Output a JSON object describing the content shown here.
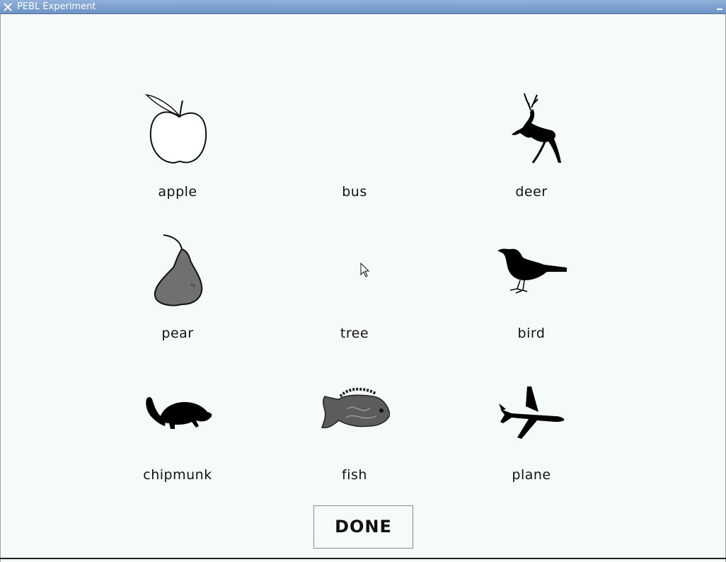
{
  "window": {
    "title": "PEBL Experiment"
  },
  "grid": {
    "items": [
      {
        "label": "apple",
        "icon": "apple-icon"
      },
      {
        "label": "bus",
        "icon": ""
      },
      {
        "label": "deer",
        "icon": "deer-icon"
      },
      {
        "label": "pear",
        "icon": "pear-icon"
      },
      {
        "label": "tree",
        "icon": ""
      },
      {
        "label": "bird",
        "icon": "bird-icon"
      },
      {
        "label": "chipmunk",
        "icon": "chipmunk-icon"
      },
      {
        "label": "fish",
        "icon": "fish-icon"
      },
      {
        "label": "plane",
        "icon": "plane-icon"
      }
    ]
  },
  "done_button": {
    "label": "DONE"
  }
}
